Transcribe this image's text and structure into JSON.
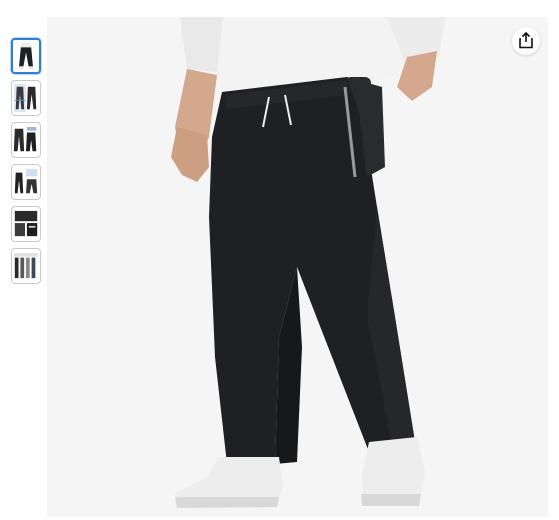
{
  "gallery": {
    "thumbnails": [
      {
        "icon": "pants-front-view-thumbnail",
        "selected": true
      },
      {
        "icon": "size-detail-thumbnail",
        "selected": false
      },
      {
        "icon": "pants-pair-thumbnail",
        "selected": false
      },
      {
        "icon": "model-detail-thumbnail",
        "selected": false
      },
      {
        "icon": "fabric-detail-thumbnail",
        "selected": false
      },
      {
        "icon": "color-options-thumbnail",
        "selected": false
      }
    ],
    "main_image": {
      "subject": "black-sweatpants-product-photo"
    },
    "share_icon": "share-icon"
  },
  "colors": {
    "accent": "#2f7fd6",
    "pants": "#1f2023",
    "background": "#f5f5f5"
  }
}
